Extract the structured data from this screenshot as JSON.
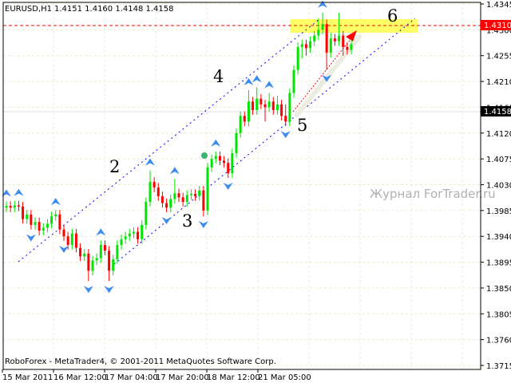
{
  "header": {
    "symbol": "EURUSD,H1",
    "ohlc_text": "1.4151 1.4160 1.4148 1.4158"
  },
  "footer": {
    "copyright": "RoboForex - MetaTrader4, © 2001-2011 MetaQuotes Software Corp."
  },
  "watermark": "Журнал ForTrader.ru",
  "colors": {
    "bull": "#00e600",
    "bear": "#ff0000",
    "fractal": "#3c8cf0",
    "channel": "#0000ff",
    "target_zone": "#ffff66",
    "level_line": "#ff0000",
    "grid": "#ecebd2"
  },
  "chart_data": {
    "type": "candlestick",
    "symbol": "EURUSD",
    "timeframe": "H1",
    "ylim": [
      1.3715,
      1.4345
    ],
    "y_ticks": [
      "1.4345",
      "1.4300",
      "1.4255",
      "1.4210",
      "1.4165",
      "1.4120",
      "1.4075",
      "1.4030",
      "1.3985",
      "1.3940",
      "1.3895",
      "1.3850",
      "1.3805",
      "1.3760",
      "1.3715"
    ],
    "x_ticks": [
      "15 Mar 2011",
      "16 Mar 12:00",
      "17 Mar 04:00",
      "17 Mar 20:00",
      "18 Mar 12:00",
      "21 Mar 05:00"
    ],
    "price_labels": {
      "level": "1.4310",
      "current": "1.4158"
    },
    "wave_labels": [
      "2",
      "3",
      "4",
      "5",
      "6"
    ],
    "candles": [
      [
        1.399,
        1.4001,
        1.3982,
        1.3993
      ],
      [
        1.3993,
        1.4001,
        1.3982,
        1.399
      ],
      [
        1.399,
        1.4002,
        1.3982,
        1.3994
      ],
      [
        1.3994,
        1.4002,
        1.3984,
        1.3992
      ],
      [
        1.3992,
        1.4,
        1.3962,
        1.397
      ],
      [
        1.397,
        1.3986,
        1.3962,
        1.3978
      ],
      [
        1.3978,
        1.3986,
        1.3952,
        1.396
      ],
      [
        1.396,
        1.3973,
        1.3952,
        1.3965
      ],
      [
        1.3965,
        1.3973,
        1.3942,
        1.395
      ],
      [
        1.395,
        1.3963,
        1.3942,
        1.3955
      ],
      [
        1.3955,
        1.397,
        1.3947,
        1.3962
      ],
      [
        1.3962,
        1.3983,
        1.3954,
        1.3975
      ],
      [
        1.3975,
        1.3986,
        1.3967,
        1.3978
      ],
      [
        1.3978,
        1.3986,
        1.3944,
        1.3952
      ],
      [
        1.3952,
        1.396,
        1.3932,
        1.394
      ],
      [
        1.394,
        1.3948,
        1.3917,
        1.3925
      ],
      [
        1.3925,
        1.3953,
        1.3917,
        1.3945
      ],
      [
        1.3945,
        1.3953,
        1.3912,
        1.392
      ],
      [
        1.392,
        1.3928,
        1.3897,
        1.3905
      ],
      [
        1.3905,
        1.3918,
        1.3897,
        1.391
      ],
      [
        1.391,
        1.3918,
        1.3862,
        1.388
      ],
      [
        1.388,
        1.3906,
        1.3872,
        1.3898
      ],
      [
        1.3898,
        1.391,
        1.389,
        1.3902
      ],
      [
        1.3902,
        1.3933,
        1.3894,
        1.3925
      ],
      [
        1.3925,
        1.3933,
        1.3907,
        1.3915
      ],
      [
        1.3915,
        1.3923,
        1.3862,
        1.388
      ],
      [
        1.388,
        1.3908,
        1.3872,
        1.39
      ],
      [
        1.39,
        1.3933,
        1.3892,
        1.3925
      ],
      [
        1.3925,
        1.3943,
        1.3917,
        1.3935
      ],
      [
        1.3935,
        1.3948,
        1.3927,
        1.394
      ],
      [
        1.394,
        1.3953,
        1.3932,
        1.3945
      ],
      [
        1.3945,
        1.3956,
        1.3937,
        1.3948
      ],
      [
        1.3948,
        1.3956,
        1.3927,
        1.3935
      ],
      [
        1.3935,
        1.3968,
        1.3927,
        1.396
      ],
      [
        1.396,
        1.4008,
        1.3952,
        1.4
      ],
      [
        1.4,
        1.4055,
        1.3992,
        1.4035
      ],
      [
        1.4035,
        1.4043,
        1.4017,
        1.4025
      ],
      [
        1.4025,
        1.4033,
        1.4002,
        1.401
      ],
      [
        1.401,
        1.4018,
        1.399,
        1.3998
      ],
      [
        1.3998,
        1.4006,
        1.3982,
        1.399
      ],
      [
        1.399,
        1.4013,
        1.3982,
        1.4005
      ],
      [
        1.4005,
        1.404,
        1.3997,
        1.4015
      ],
      [
        1.4015,
        1.4023,
        1.4,
        1.4008
      ],
      [
        1.4008,
        1.4016,
        1.3992,
        1.4
      ],
      [
        1.4,
        1.402,
        1.3992,
        1.4012
      ],
      [
        1.4012,
        1.4022,
        1.4004,
        1.4014
      ],
      [
        1.4014,
        1.4022,
        1.4002,
        1.401
      ],
      [
        1.401,
        1.4028,
        1.4002,
        1.402
      ],
      [
        1.402,
        1.4028,
        1.3975,
        1.3985
      ],
      [
        1.3985,
        1.4068,
        1.3977,
        1.406
      ],
      [
        1.406,
        1.4083,
        1.4052,
        1.4075
      ],
      [
        1.4075,
        1.4088,
        1.4067,
        1.408
      ],
      [
        1.408,
        1.4088,
        1.4064,
        1.4072
      ],
      [
        1.4072,
        1.408,
        1.406,
        1.4068
      ],
      [
        1.4068,
        1.4076,
        1.4042,
        1.405
      ],
      [
        1.405,
        1.4093,
        1.4042,
        1.4085
      ],
      [
        1.4085,
        1.4128,
        1.4077,
        1.412
      ],
      [
        1.412,
        1.4158,
        1.4112,
        1.415
      ],
      [
        1.415,
        1.4158,
        1.4132,
        1.414
      ],
      [
        1.414,
        1.4195,
        1.4132,
        1.4175
      ],
      [
        1.4175,
        1.4183,
        1.4152,
        1.416
      ],
      [
        1.416,
        1.42,
        1.4152,
        1.418
      ],
      [
        1.418,
        1.4188,
        1.4162,
        1.417
      ],
      [
        1.417,
        1.4178,
        1.414,
        1.4165
      ],
      [
        1.4165,
        1.419,
        1.4157,
        1.4175
      ],
      [
        1.4175,
        1.4183,
        1.4152,
        1.416
      ],
      [
        1.416,
        1.4185,
        1.4152,
        1.417
      ],
      [
        1.417,
        1.4178,
        1.4142,
        1.415
      ],
      [
        1.415,
        1.417,
        1.4132,
        1.414
      ],
      [
        1.414,
        1.4198,
        1.4132,
        1.419
      ],
      [
        1.419,
        1.4238,
        1.4182,
        1.423
      ],
      [
        1.423,
        1.4278,
        1.4222,
        1.427
      ],
      [
        1.427,
        1.4283,
        1.425,
        1.4275
      ],
      [
        1.4275,
        1.4283,
        1.4255,
        1.4268
      ],
      [
        1.4268,
        1.4288,
        1.426,
        1.428
      ],
      [
        1.428,
        1.4298,
        1.4272,
        1.429
      ],
      [
        1.429,
        1.432,
        1.4282,
        1.43
      ],
      [
        1.43,
        1.433,
        1.4292,
        1.431
      ],
      [
        1.431,
        1.4318,
        1.423,
        1.426
      ],
      [
        1.426,
        1.4295,
        1.4252,
        1.4285
      ],
      [
        1.4285,
        1.4293,
        1.4272,
        1.428
      ],
      [
        1.428,
        1.433,
        1.4272,
        1.429
      ],
      [
        1.429,
        1.4298,
        1.4255,
        1.427
      ],
      [
        1.427,
        1.4278,
        1.4257,
        1.4265
      ],
      [
        1.4265,
        1.4283,
        1.4257,
        1.4275
      ]
    ],
    "fractals_up": [
      0,
      3,
      12,
      23,
      35,
      41,
      51,
      59,
      61,
      64,
      77
    ],
    "fractals_down": [
      6,
      14,
      20,
      25,
      39,
      48,
      54,
      68,
      78
    ],
    "grid": true
  }
}
